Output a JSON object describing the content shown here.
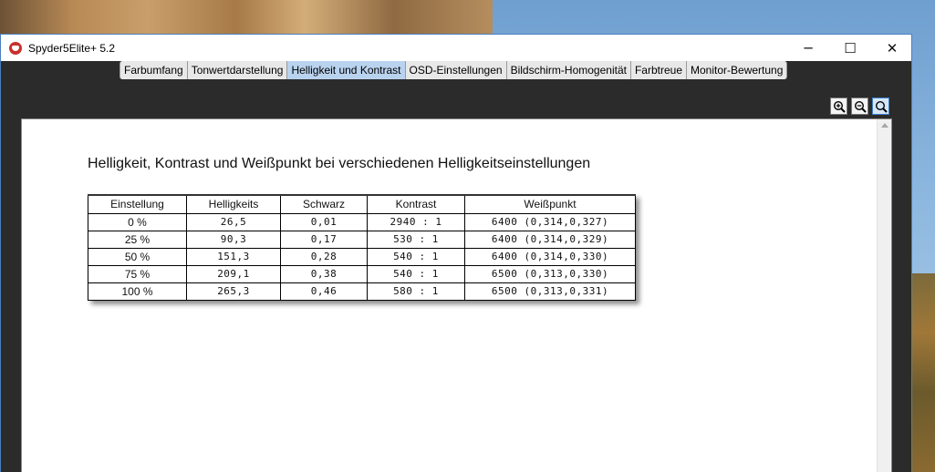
{
  "window": {
    "title": "Spyder5Elite+ 5.2",
    "controls": {
      "minimize": "─",
      "maximize": "☐",
      "close": "✕"
    }
  },
  "tabs": [
    {
      "label": "Farbumfang",
      "active": false
    },
    {
      "label": "Tonwertdarstellung",
      "active": false
    },
    {
      "label": "Helligkeit und Kontrast",
      "active": true
    },
    {
      "label": "OSD-Einstellungen",
      "active": false
    },
    {
      "label": "Bildschirm-Homogenität",
      "active": false
    },
    {
      "label": "Farbtreue",
      "active": false
    },
    {
      "label": "Monitor-Bewertung",
      "active": false
    }
  ],
  "zoom_controls": [
    "zoom-in-icon",
    "zoom-out-icon",
    "zoom-reset-icon"
  ],
  "report": {
    "title": "Helligkeit, Kontrast und Weißpunkt bei verschiedenen Helligkeitseinstellungen",
    "columns": [
      "Einstellung",
      "Helligkeits",
      "Schwarz",
      "Kontrast",
      "Weißpunkt"
    ],
    "rows": [
      [
        "0 %",
        "26,5",
        "0,01",
        "2940 : 1",
        "6400 (0,314,0,327)"
      ],
      [
        "25 %",
        "90,3",
        "0,17",
        "530 : 1",
        "6400 (0,314,0,329)"
      ],
      [
        "50 %",
        "151,3",
        "0,28",
        "540 : 1",
        "6400 (0,314,0,330)"
      ],
      [
        "75 %",
        "209,1",
        "0,38",
        "540 : 1",
        "6500 (0,313,0,330)"
      ],
      [
        "100 %",
        "265,3",
        "0,46",
        "580 : 1",
        "6500 (0,313,0,331)"
      ]
    ]
  },
  "colors": {
    "active_tab": "#b9d3ef",
    "window_frame": "#2b2b2b",
    "title_bar": "#ffffff",
    "window_border": "#4a7fc0"
  }
}
